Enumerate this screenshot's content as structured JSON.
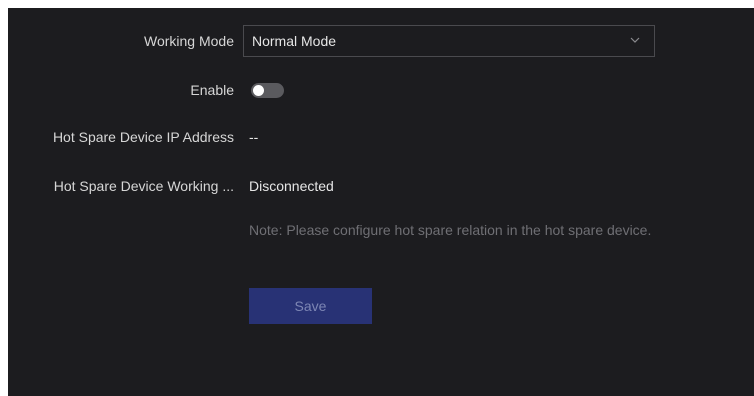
{
  "form": {
    "working_mode": {
      "label": "Working Mode",
      "value": "Normal Mode",
      "icon": "chevron-down-icon"
    },
    "enable": {
      "label": "Enable",
      "state": "off"
    },
    "hot_spare_ip": {
      "label": "Hot Spare Device IP Address",
      "value": "--"
    },
    "hot_spare_status": {
      "label": "Hot Spare Device Working ...",
      "value": "Disconnected"
    },
    "note": "Note: Please configure hot spare relation in the hot spare device.",
    "save_label": "Save"
  },
  "colors": {
    "background": "#1c1c1f",
    "text": "#e6e6e6",
    "muted_text": "#6f6f74",
    "save_button": "#283275",
    "save_button_text": "#7d86b4"
  }
}
